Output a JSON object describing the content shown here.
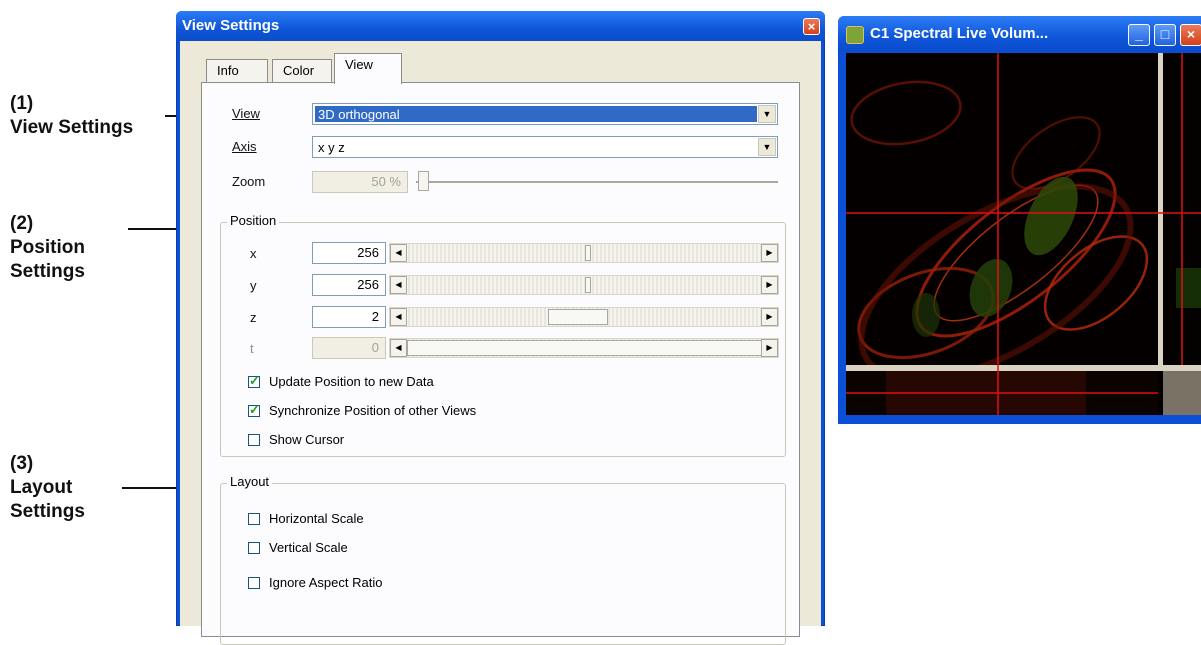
{
  "annotations": [
    {
      "num": "(1)",
      "text": "View Settings"
    },
    {
      "num": "(2)",
      "text_line1": "Position",
      "text_line2": "Settings"
    },
    {
      "num": "(3)",
      "text_line1": "Layout",
      "text_line2": "Settings"
    }
  ],
  "dialog": {
    "title": "View Settings",
    "close_glyph": "×",
    "tabs": [
      "Info",
      "Color",
      "View"
    ],
    "active_tab": "View",
    "view_label": "View",
    "view_value": "3D orthogonal",
    "axis_label": "Axis",
    "axis_value": "x y z",
    "zoom_label": "Zoom",
    "zoom_value": "50 %",
    "position": {
      "title": "Position",
      "rows": [
        {
          "label": "x",
          "value": "256",
          "fraction": 0.5,
          "enabled": true
        },
        {
          "label": "y",
          "value": "256",
          "fraction": 0.5,
          "enabled": true
        },
        {
          "label": "z",
          "value": "2",
          "fraction": 0.48,
          "enabled": true
        },
        {
          "label": "t",
          "value": "0",
          "fraction": 1.0,
          "enabled": false
        }
      ],
      "checkboxes": [
        {
          "label": "Update Position to new Data",
          "checked": true
        },
        {
          "label": "Synchronize Position of other Views",
          "checked": true
        },
        {
          "label": "Show Cursor",
          "checked": false
        }
      ]
    },
    "layout": {
      "title": "Layout",
      "checkboxes": [
        {
          "label": "Horizontal Scale",
          "checked": false
        },
        {
          "label": "Vertical Scale",
          "checked": false
        },
        {
          "label": "Ignore Aspect Ratio",
          "checked": false
        }
      ]
    }
  },
  "live_window": {
    "title": "C1 Spectral Live Volum...",
    "minimize_glyph": "_",
    "maximize_glyph": "□",
    "close_glyph": "×"
  },
  "colors": {
    "titlebar": "#0f56d8",
    "selection": "#316ac5",
    "crosshair": "#e01010",
    "image_bg": "#050000"
  }
}
